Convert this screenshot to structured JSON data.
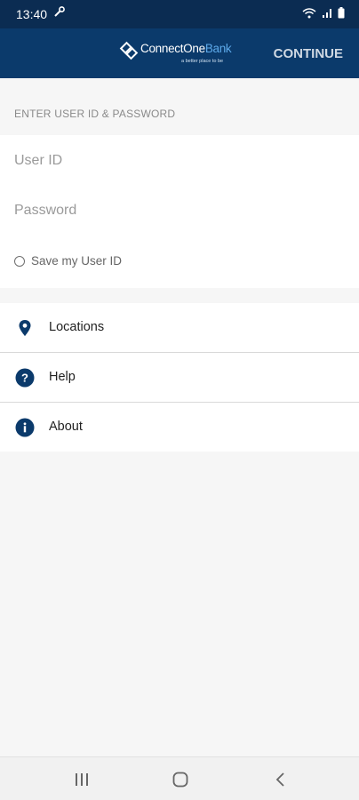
{
  "status_bar": {
    "time": "13:40"
  },
  "app_bar": {
    "logo_name": "ConnectOne",
    "logo_bank": "Bank",
    "logo_tagline": "a better place to be",
    "continue_label": "CONTINUE"
  },
  "login": {
    "section_header": "ENTER USER ID & PASSWORD",
    "userid_placeholder": "User ID",
    "password_placeholder": "Password",
    "save_label": "Save my User ID"
  },
  "menu": {
    "items": [
      {
        "label": "Locations",
        "icon": "location-pin-icon"
      },
      {
        "label": "Help",
        "icon": "help-icon"
      },
      {
        "label": "About",
        "icon": "info-icon"
      }
    ]
  },
  "colors": {
    "app_bar": "#0b3a6b",
    "status_bar": "#0b2c52",
    "accent": "#0b3a6b",
    "logo_bank": "#5da9e9"
  }
}
